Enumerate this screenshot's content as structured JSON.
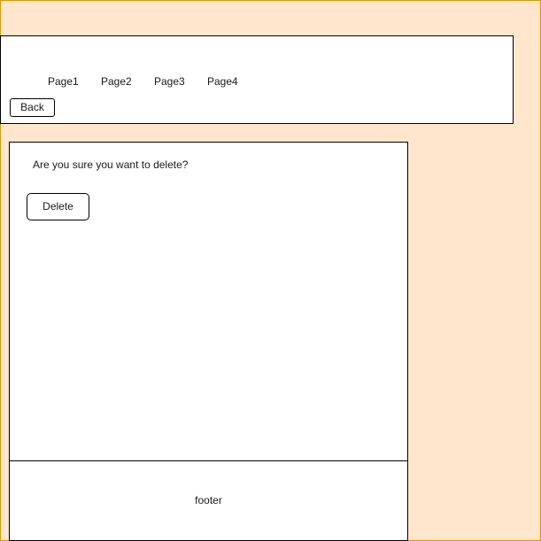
{
  "header": {
    "nav": [
      {
        "label": "Page1"
      },
      {
        "label": "Page2"
      },
      {
        "label": "Page3"
      },
      {
        "label": "Page4"
      }
    ],
    "back_label": "Back"
  },
  "main": {
    "confirm_text": "Are you sure you want to delete?",
    "delete_label": "Delete"
  },
  "footer": {
    "label": "footer"
  },
  "colors": {
    "page_background": "#ffe6cc",
    "page_border": "#d79b00",
    "panel_background": "#ffffff",
    "panel_border": "#000000"
  }
}
